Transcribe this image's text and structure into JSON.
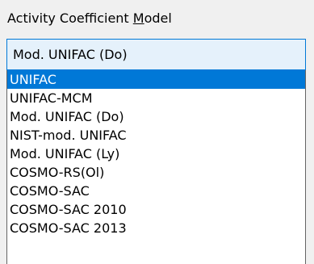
{
  "group_label_before": "Activity Coefficient ",
  "group_label_mnemonic": "M",
  "group_label_after": "odel",
  "combo": {
    "selected_value": "Mod. UNIFAC (Do)"
  },
  "dropdown": {
    "options": [
      {
        "label": "UNIFAC",
        "highlighted": true
      },
      {
        "label": "UNIFAC-MCM",
        "highlighted": false
      },
      {
        "label": "Mod. UNIFAC (Do)",
        "highlighted": false
      },
      {
        "label": "NIST-mod. UNIFAC",
        "highlighted": false
      },
      {
        "label": "Mod. UNIFAC (Ly)",
        "highlighted": false
      },
      {
        "label": "COSMO-RS(Ol)",
        "highlighted": false
      },
      {
        "label": "COSMO-SAC",
        "highlighted": false
      },
      {
        "label": "COSMO-SAC 2010",
        "highlighted": false
      },
      {
        "label": "COSMO-SAC 2013",
        "highlighted": false
      },
      {
        "label": "",
        "highlighted": false
      }
    ]
  },
  "colors": {
    "highlight": "#0078d7",
    "combo_background": "#e5f1fb",
    "window_background": "#f0f0f0"
  }
}
